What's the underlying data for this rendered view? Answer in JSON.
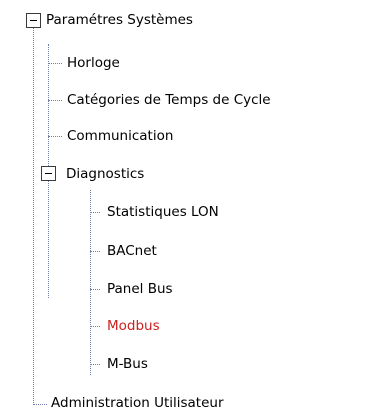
{
  "tree": {
    "root": {
      "label": "Paramétres Systèmes",
      "expanded": true,
      "children": [
        {
          "label": "Horloge"
        },
        {
          "label": "Catégories de Temps de Cycle"
        },
        {
          "label": "Communication"
        },
        {
          "label": "Diagnostics",
          "expanded": true,
          "children": [
            {
              "label": "Statistiques LON"
            },
            {
              "label": "BACnet"
            },
            {
              "label": "Panel Bus"
            },
            {
              "label": "Modbus",
              "selected": true
            },
            {
              "label": "M-Bus"
            }
          ]
        }
      ]
    },
    "sibling": {
      "label": "Administration Utilisateur"
    }
  },
  "colors": {
    "selected_text": "#cc1f1f",
    "connector": "#6f7fa7"
  }
}
